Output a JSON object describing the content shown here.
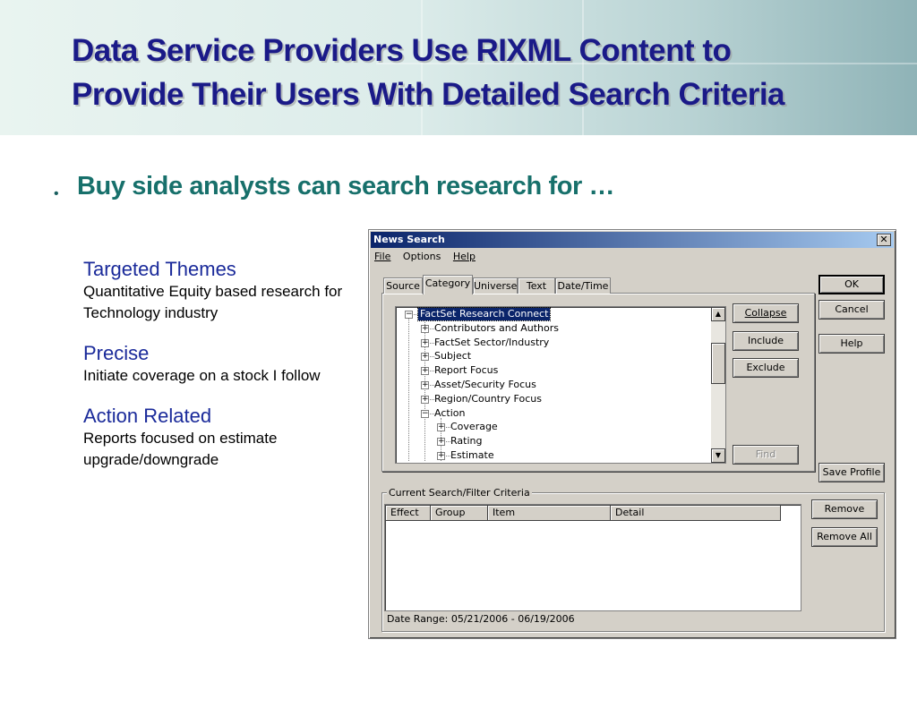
{
  "slide": {
    "title_line1": "Data Service Providers Use RIXML Content to",
    "title_line2": "Provide Their Users With Detailed Search Criteria",
    "bullet": "Buy side analysts can search research for …",
    "points": [
      {
        "head": "Targeted Themes",
        "body": "Quantitative Equity based research for Technology industry"
      },
      {
        "head": "Precise",
        "body": "Initiate coverage on a stock I follow"
      },
      {
        "head": "Action Related",
        "body": "Reports focused on estimate upgrade/downgrade"
      }
    ]
  },
  "dialog": {
    "title": "News Search",
    "close": "✕",
    "menu": [
      "File",
      "Options",
      "Help"
    ],
    "tabs": [
      "Source",
      "Category",
      "Universe",
      "Text",
      "Date/Time"
    ],
    "active_tab": "Category",
    "tree": [
      {
        "label": "FactSet Research Connect",
        "level": 0,
        "expander": "−",
        "selected": true
      },
      {
        "label": "Contributors and Authors",
        "level": 1,
        "expander": "+"
      },
      {
        "label": "FactSet Sector/Industry",
        "level": 1,
        "expander": "+"
      },
      {
        "label": "Subject",
        "level": 1,
        "expander": "+"
      },
      {
        "label": "Report Focus",
        "level": 1,
        "expander": "+"
      },
      {
        "label": "Asset/Security Focus",
        "level": 1,
        "expander": "+"
      },
      {
        "label": "Region/Country Focus",
        "level": 1,
        "expander": "+"
      },
      {
        "label": "Action",
        "level": 1,
        "expander": "−"
      },
      {
        "label": "Coverage",
        "level": 2,
        "expander": "+"
      },
      {
        "label": "Rating",
        "level": 2,
        "expander": "+"
      },
      {
        "label": "Estimate",
        "level": 2,
        "expander": "+"
      }
    ],
    "tree_buttons": {
      "collapse": "Collapse",
      "include": "Include",
      "exclude": "Exclude",
      "find": "Find"
    },
    "right_buttons": {
      "ok": "OK",
      "cancel": "Cancel",
      "help": "Help",
      "save_profile": "Save Profile"
    },
    "criteria": {
      "group_label": "Current Search/Filter Criteria",
      "columns": [
        "Effect",
        "Group",
        "Item",
        "Detail"
      ],
      "rows": [],
      "remove": "Remove",
      "remove_all": "Remove All",
      "date_range": "Date Range: 05/21/2006 - 06/19/2006"
    }
  }
}
